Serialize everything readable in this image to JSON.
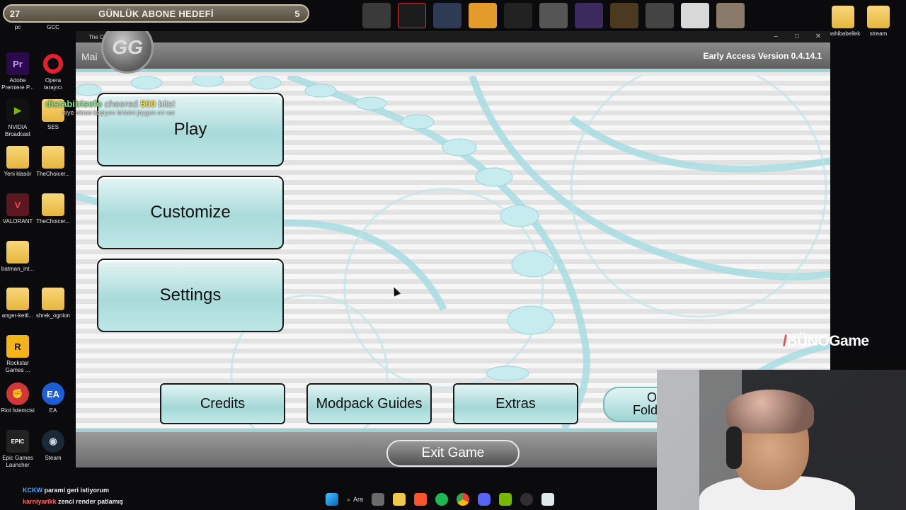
{
  "overlay": {
    "goal_left": "27",
    "goal_title": "GÜNLÜK ABONE HEDEFİ",
    "goal_right": "5"
  },
  "desktop_icons": [
    {
      "label": "pc"
    },
    {
      "label": "GCC"
    },
    {
      "label": "Adobe Premiere P..."
    },
    {
      "label": "Opera tarayıcı"
    },
    {
      "label": "NVIDIA Broadcast"
    },
    {
      "label": "SES"
    },
    {
      "label": "Yeni klasör"
    },
    {
      "label": "TheChoicer..."
    },
    {
      "label": "VALORANT"
    },
    {
      "label": "TheChoicer..."
    },
    {
      "label": "batman_int..."
    },
    {
      "label": "anger-kettl..."
    },
    {
      "label": "shrek_ognion"
    },
    {
      "label": "Rockstar Games ..."
    },
    {
      "label": "Riot İstemcisi"
    },
    {
      "label": "EA"
    },
    {
      "label": "Epic Games Launcher"
    },
    {
      "label": "Steam"
    }
  ],
  "top_icons": [
    {
      "label": "kashibabellek"
    },
    {
      "label": "stream"
    }
  ],
  "window": {
    "title": "The Ch",
    "menu_title": "Mai",
    "version": "Early Access Version 0.4.14.1",
    "logo": "GG"
  },
  "menu": {
    "play": "Play",
    "customize": "Customize",
    "settings": "Settings",
    "credits": "Credits",
    "modpack_guides": "Modpack Guides",
    "extras": "Extras",
    "open_folder_1": "O",
    "open_folder_2": "Folde",
    "exit": "Exit Game"
  },
  "chat_overlay": {
    "user": "distabibisefo",
    "action": "cheered",
    "amount": "500",
    "suffix": "bits!",
    "sub": "niye ekran kapiyon birisini joygun mi var"
  },
  "brand": {
    "accent": "/",
    "name": "BÜNOGame"
  },
  "chat": [
    {
      "name": "KCKW",
      "msg": "parami geri istiyorum"
    },
    {
      "name": "karniyarikk",
      "msg": "zenci render patlamış"
    }
  ],
  "taskbar": {
    "search": "Ara"
  },
  "colors": {
    "accent": "#9fd3d8",
    "button": "#a9dada"
  }
}
